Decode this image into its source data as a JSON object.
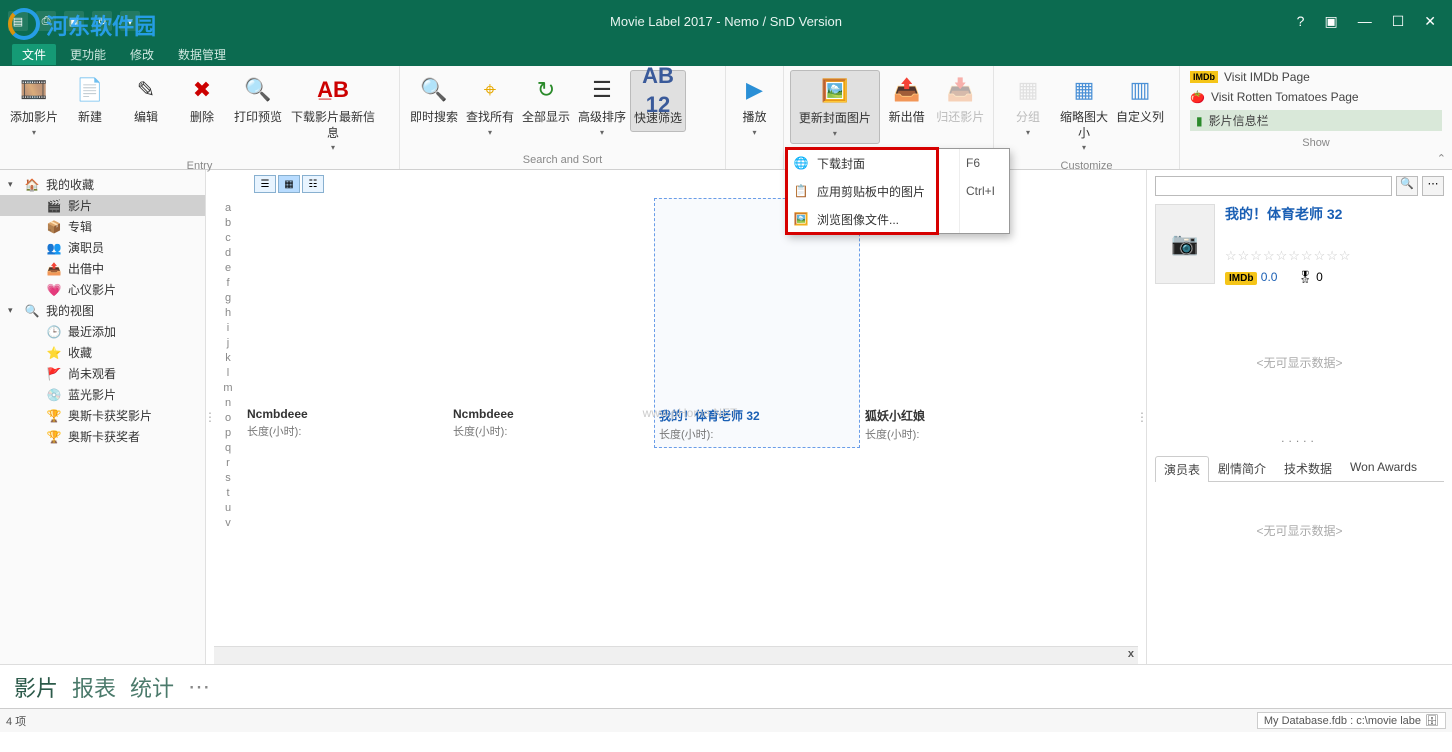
{
  "app_title": "Movie Label 2017 - Nemo / SnD Version",
  "watermark_text": "河东软件园",
  "menu": {
    "file": "文件",
    "functions": "更功能",
    "modify": "修改",
    "data_mgmt": "数据管理"
  },
  "ribbon": {
    "entry": {
      "label": "Entry",
      "add_movie": "添加影片",
      "new": "新建",
      "edit": "编辑",
      "delete": "删除",
      "print_preview": "打印预览",
      "download_info": "下载影片最新信息"
    },
    "search": {
      "label": "Search and Sort",
      "instant_search": "即时搜索",
      "find_all": "查找所有",
      "show_all": "全部显示",
      "adv_sort": "高级排序",
      "quick_filter": "快速筛选"
    },
    "play": "播放",
    "loan": {
      "update_cover": "更新封面图片",
      "new_loan": "新出借",
      "return": "归还影片"
    },
    "customize": {
      "label": "Customize",
      "group": "分组",
      "thumb_size": "缩略图大小",
      "custom_cols": "自定义列"
    },
    "show": {
      "label": "Show",
      "imdb": "Visit IMDb Page",
      "rt": "Visit Rotten Tomatoes Page",
      "info_bar": "影片信息栏"
    }
  },
  "dropdown": {
    "download_cover": "下载封面",
    "download_cover_sc": "F6",
    "apply_clipboard": "应用剪贴板中的图片",
    "apply_clipboard_sc": "Ctrl+I",
    "browse_image": "浏览图像文件..."
  },
  "sidebar": {
    "my_collection": "我的收藏",
    "items1": [
      "影片",
      "专辑",
      "演职员",
      "出借中",
      "心仪影片"
    ],
    "my_views": "我的视图",
    "items2": [
      "最近添加",
      "收藏",
      "尚未观看",
      "蓝光影片",
      "奥斯卡获奖影片",
      "奥斯卡获奖者"
    ]
  },
  "az": [
    "a",
    "b",
    "c",
    "d",
    "e",
    "f",
    "g",
    "h",
    "i",
    "j",
    "k",
    "l",
    "m",
    "n",
    "o",
    "p",
    "q",
    "r",
    "s",
    "t",
    "u",
    "v"
  ],
  "cards": [
    {
      "title": "Ncmbdeee",
      "sub": "长度(小时):"
    },
    {
      "title": "Ncmbdeee",
      "sub": "长度(小时):"
    },
    {
      "title": "我的！体育老师 32",
      "sub": "长度(小时):",
      "selected": true
    },
    {
      "title": "狐妖小红娘",
      "sub": "长度(小时):"
    }
  ],
  "center_watermark": "www.pHome.NET",
  "info": {
    "title": "我的！体育老师 32",
    "stars": "☆☆☆☆☆☆☆☆☆☆",
    "imdb_score": "0.0",
    "other_score": "0",
    "no_data": "<无可显示数据>",
    "tabs": [
      "演员表",
      "剧情简介",
      "技术数据",
      "Won Awards"
    ]
  },
  "bottom_tabs": [
    "影片",
    "报表",
    "统计"
  ],
  "status": {
    "count": "4 项",
    "db": "My Database.fdb  :  c:\\movie labe"
  }
}
